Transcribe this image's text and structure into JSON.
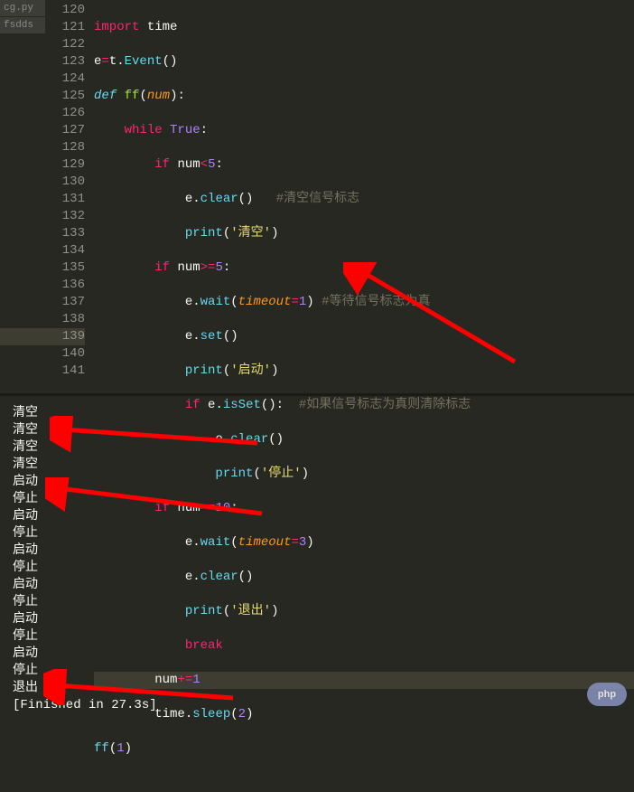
{
  "tabs": [
    "cg.py",
    "fsdds"
  ],
  "gutter_start": 120,
  "gutter_end": 141,
  "highlighted_line": 139,
  "output": {
    "lines": [
      "清空",
      "清空",
      "清空",
      "清空",
      "启动",
      "停止",
      "启动",
      "停止",
      "启动",
      "停止",
      "启动",
      "停止",
      "启动",
      "停止",
      "启动",
      "停止",
      "退出",
      "[Finished in 27.3s]"
    ]
  },
  "code": {
    "l120": {
      "kw": "import",
      "mod": "time"
    },
    "l121": {
      "v": "e",
      "eq": "=",
      "t": "t",
      "dot": ".",
      "fn": "Event",
      "p": "()"
    },
    "l122": {
      "def": "def",
      "name": "ff",
      "p1": "(",
      "arg": "num",
      "p2": "):"
    },
    "l123": {
      "kw": "while",
      "val": "True",
      "c": ":"
    },
    "l124": {
      "kw": "if",
      "expr": "num",
      "op": "<",
      "n": "5",
      "c": ":"
    },
    "l125": {
      "obj": "e",
      "fn": "clear",
      "p": "()",
      "cm": "#清空信号标志"
    },
    "l126": {
      "fn": "print",
      "p1": "(",
      "s": "'清空'",
      "p2": ")"
    },
    "l127": {
      "kw": "if",
      "expr": "num",
      "op": ">=",
      "n": "5",
      "c": ":"
    },
    "l128": {
      "obj": "e",
      "fn": "wait",
      "p1": "(",
      "kwarg": "timeout",
      "eq": "=",
      "n": "1",
      "p2": ")",
      "cm": "#等待信号标志为真"
    },
    "l129": {
      "obj": "e",
      "fn": "set",
      "p": "()"
    },
    "l130": {
      "fn": "print",
      "p1": "(",
      "s": "'启动'",
      "p2": ")"
    },
    "l131": {
      "kw": "if",
      "obj": "e",
      "fn": "isSet",
      "p": "():",
      "cm": "#如果信号标志为真则清除标志"
    },
    "l132": {
      "obj": "e",
      "fn": "clear",
      "p": "()"
    },
    "l133": {
      "fn": "print",
      "p1": "(",
      "s": "'停止'",
      "p2": ")"
    },
    "l134": {
      "kw": "if",
      "expr": "num",
      "op": "==",
      "n": "10",
      "c": ":"
    },
    "l135": {
      "obj": "e",
      "fn": "wait",
      "p1": "(",
      "kwarg": "timeout",
      "eq": "=",
      "n": "3",
      "p2": ")"
    },
    "l136": {
      "obj": "e",
      "fn": "clear",
      "p": "()"
    },
    "l137": {
      "fn": "print",
      "p1": "(",
      "s": "'退出'",
      "p2": ")"
    },
    "l138": {
      "kw": "break"
    },
    "l139": {
      "expr": "num",
      "op": "+=",
      "n": "1"
    },
    "l140": {
      "obj": "time",
      "fn": "sleep",
      "p1": "(",
      "n": "2",
      "p2": ")"
    },
    "l141": {
      "fn": "ff",
      "p1": "(",
      "n": "1",
      "p2": ")"
    }
  },
  "watermark": "php"
}
